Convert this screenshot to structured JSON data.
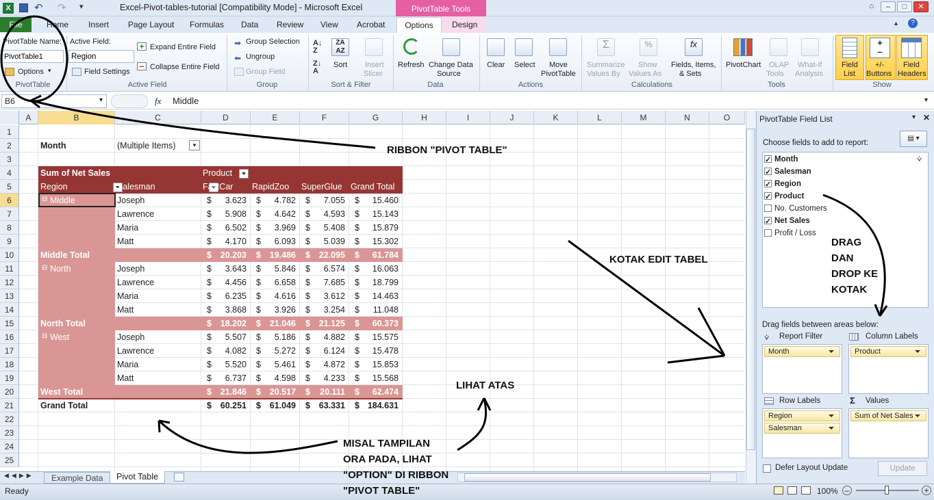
{
  "window": {
    "title": "Excel-Pivot-tables-tutorial  [Compatibility Mode]  -  Microsoft Excel",
    "context_tab_group": "PivotTable Tools"
  },
  "tabs": [
    "File",
    "Home",
    "Insert",
    "Page Layout",
    "Formulas",
    "Data",
    "Review",
    "View",
    "Acrobat",
    "Options",
    "Design"
  ],
  "ribbon": {
    "pivottable": {
      "name_label": "PivotTable Name:",
      "name_value": "PivotTable1",
      "options": "Options",
      "group": "PivotTable"
    },
    "active_field": {
      "label": "Active Field:",
      "value": "Region",
      "field_settings": "Field Settings",
      "expand": "Expand Entire Field",
      "collapse": "Collapse Entire Field",
      "group": "Active Field"
    },
    "group": {
      "group_selection": "Group Selection",
      "ungroup": "Ungroup",
      "group_field": "Group Field",
      "group": "Group"
    },
    "sort_filter": {
      "sort": "Sort",
      "insert_slicer_1": "Insert",
      "insert_slicer_2": "Slicer",
      "group": "Sort & Filter"
    },
    "data": {
      "refresh": "Refresh",
      "change_source_1": "Change Data",
      "change_source_2": "Source",
      "group": "Data"
    },
    "actions": {
      "clear": "Clear",
      "select": "Select",
      "move_1": "Move",
      "move_2": "PivotTable",
      "group": "Actions"
    },
    "calculations": {
      "summarize_1": "Summarize",
      "summarize_2": "Values By",
      "show_1": "Show",
      "show_2": "Values As",
      "fields_1": "Fields, Items,",
      "fields_2": "& Sets",
      "group": "Calculations"
    },
    "tools": {
      "pivotchart": "PivotChart",
      "olap_1": "OLAP",
      "olap_2": "Tools",
      "whatif_1": "What-If",
      "whatif_2": "Analysis",
      "group": "Tools"
    },
    "show": {
      "field_list_1": "Field",
      "field_list_2": "List",
      "buttons_1": "+/-",
      "buttons_2": "Buttons",
      "headers_1": "Field",
      "headers_2": "Headers",
      "group": "Show"
    }
  },
  "formula_bar": {
    "name_box": "B6",
    "fx": "fx",
    "value": "Middle"
  },
  "columns": [
    "A",
    "B",
    "C",
    "D",
    "E",
    "F",
    "G",
    "H",
    "I",
    "J",
    "K",
    "L",
    "M",
    "N",
    "O"
  ],
  "rows": [
    "1",
    "2",
    "3",
    "4",
    "5",
    "6",
    "7",
    "8",
    "9",
    "10",
    "11",
    "12",
    "13",
    "14",
    "15",
    "16",
    "17",
    "18",
    "19",
    "20",
    "21",
    "22",
    "23",
    "24",
    "25"
  ],
  "pivot": {
    "filter_field": "Month",
    "filter_value": "(Multiple Items)",
    "data_caption": "Sum of Net Sales",
    "col_field": "Product",
    "row_field_1": "Region",
    "row_field_2": "Salesman",
    "col_headers": [
      "FastCar",
      "RapidZoo",
      "SuperGlue",
      "Grand Total"
    ],
    "currency": "$",
    "regions": [
      {
        "name": "Middle",
        "rows": [
          {
            "salesman": "Joseph",
            "values": [
              "3.623",
              "4.782",
              "7.055",
              "15.460"
            ]
          },
          {
            "salesman": "Lawrence",
            "values": [
              "5.908",
              "4.642",
              "4.593",
              "15.143"
            ]
          },
          {
            "salesman": "Maria",
            "values": [
              "6.502",
              "3.969",
              "5.408",
              "15.879"
            ]
          },
          {
            "salesman": "Matt",
            "values": [
              "4.170",
              "6.093",
              "5.039",
              "15.302"
            ]
          }
        ],
        "total_label": "Middle Total",
        "total": [
          "20.203",
          "19.486",
          "22.095",
          "61.784"
        ]
      },
      {
        "name": "North",
        "rows": [
          {
            "salesman": "Joseph",
            "values": [
              "3.643",
              "5.846",
              "6.574",
              "16.063"
            ]
          },
          {
            "salesman": "Lawrence",
            "values": [
              "4.456",
              "6.658",
              "7.685",
              "18.799"
            ]
          },
          {
            "salesman": "Maria",
            "values": [
              "6.235",
              "4.616",
              "3.612",
              "14.463"
            ]
          },
          {
            "salesman": "Matt",
            "values": [
              "3.868",
              "3.926",
              "3.254",
              "11.048"
            ]
          }
        ],
        "total_label": "North Total",
        "total": [
          "18.202",
          "21.046",
          "21.125",
          "60.373"
        ]
      },
      {
        "name": "West",
        "rows": [
          {
            "salesman": "Joseph",
            "values": [
              "5.507",
              "5.186",
              "4.882",
              "15.575"
            ]
          },
          {
            "salesman": "Lawrence",
            "values": [
              "4.082",
              "5.272",
              "6.124",
              "15.478"
            ]
          },
          {
            "salesman": "Maria",
            "values": [
              "5.520",
              "5.461",
              "4.872",
              "15.853"
            ]
          },
          {
            "salesman": "Matt",
            "values": [
              "6.737",
              "4.598",
              "4.233",
              "15.568"
            ]
          }
        ],
        "total_label": "West Total",
        "total": [
          "21.846",
          "20.517",
          "20.111",
          "62.474"
        ]
      }
    ],
    "grand_total_label": "Grand Total",
    "grand_total": [
      "60.251",
      "61.049",
      "63.331",
      "184.631"
    ]
  },
  "sheet_tabs": [
    "Example Data",
    "Pivot Table"
  ],
  "status": {
    "ready": "Ready",
    "zoom": "100%"
  },
  "field_list": {
    "title": "PivotTable Field List",
    "choose": "Choose fields to add to report:",
    "fields": [
      {
        "label": "Month",
        "checked": true
      },
      {
        "label": "Salesman",
        "checked": true
      },
      {
        "label": "Region",
        "checked": true
      },
      {
        "label": "Product",
        "checked": true
      },
      {
        "label": "No. Customers",
        "checked": false
      },
      {
        "label": "Net Sales",
        "checked": true
      },
      {
        "label": "Profit / Loss",
        "checked": false
      }
    ],
    "drag_label": "Drag fields between areas below:",
    "report_filter": "Report Filter",
    "column_labels": "Column Labels",
    "row_labels": "Row Labels",
    "values": "Values",
    "filter_chips": [
      "Month"
    ],
    "column_chips": [
      "Product"
    ],
    "row_chips": [
      "Region",
      "Salesman"
    ],
    "value_chips": [
      "Sum of Net Sales"
    ],
    "defer": "Defer Layout Update",
    "update": "Update"
  },
  "annotations": {
    "ribbon": "RIBBON \"PIVOT TABLE\"",
    "kotak": "KOTAK EDIT TABEL",
    "drag": [
      "DRAG",
      "DAN",
      "DROP KE",
      "KOTAK"
    ],
    "lihat": "LIHAT ATAS",
    "misal": [
      "MISAL TAMPILAN",
      "ORA PADA, LIHAT",
      "\"OPTION\" DI RIBBON",
      "\"PIVOT TABLE\""
    ]
  }
}
